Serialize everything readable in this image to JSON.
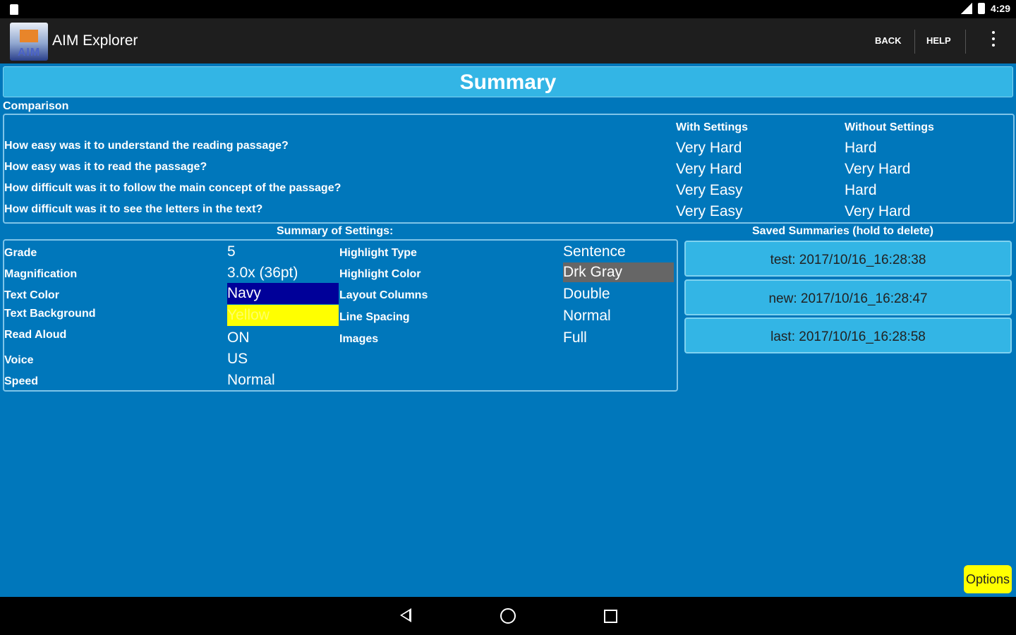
{
  "status_bar": {
    "time": "4:29"
  },
  "action_bar": {
    "app_title": "AIM Explorer",
    "logo_text": "AIM",
    "back_label": "BACK",
    "help_label": "HELP"
  },
  "page_title": "Summary",
  "comparison": {
    "label": "Comparison",
    "col_with": "With Settings",
    "col_without": "Without Settings",
    "rows": [
      {
        "question": "How easy was it to understand the reading passage?",
        "with": "Very Hard",
        "without": "Hard"
      },
      {
        "question": "How easy was it to read the passage?",
        "with": "Very Hard",
        "without": "Very Hard"
      },
      {
        "question": "How difficult was it to follow the main concept of the passage?",
        "with": "Very Easy",
        "without": "Hard"
      },
      {
        "question": "How difficult was it to see the letters in the text?",
        "with": "Very Easy",
        "without": "Very Hard"
      }
    ]
  },
  "settings": {
    "label": "Summary of Settings:",
    "left": [
      {
        "label": "Grade",
        "value": "5"
      },
      {
        "label": "Magnification",
        "value": "3.0x (36pt)"
      },
      {
        "label": "Text Color",
        "value": "Navy"
      },
      {
        "label": "Text Background",
        "value": "Yellow"
      },
      {
        "label": "Read Aloud",
        "value": "ON"
      },
      {
        "label": "Voice",
        "value": "US"
      },
      {
        "label": "Speed",
        "value": "Normal"
      }
    ],
    "right": [
      {
        "label": "Highlight Type",
        "value": "Sentence"
      },
      {
        "label": "Highlight Color",
        "value": "Drk Gray"
      },
      {
        "label": "Layout Columns",
        "value": "Double"
      },
      {
        "label": "Line Spacing",
        "value": "Normal"
      },
      {
        "label": "Images",
        "value": "Full"
      }
    ]
  },
  "saved": {
    "label": "Saved Summaries (hold to delete)",
    "items": [
      "test: 2017/10/16_16:28:38",
      "new: 2017/10/16_16:28:47",
      "last: 2017/10/16_16:28:58"
    ]
  },
  "options_label": "Options",
  "colors": {
    "navy_swatch": "#000099",
    "yellow_swatch": "#ffff00",
    "drk_gray_swatch": "#666666",
    "background": "#0077bb",
    "accent": "#33b5e5"
  }
}
